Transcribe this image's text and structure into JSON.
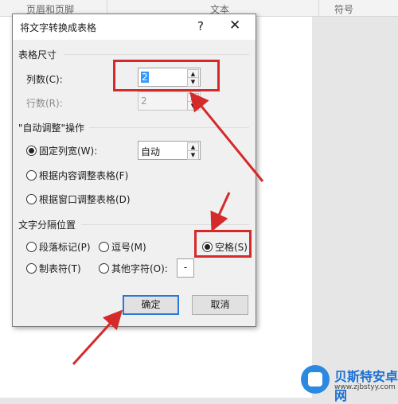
{
  "ribbon": {
    "groups": [
      "页眉和页脚",
      "文本",
      "符号"
    ]
  },
  "dialog": {
    "title": "将文字转换成表格",
    "help": "?",
    "close": "✕",
    "size_group": {
      "label": "表格尺寸",
      "columns_label": "列数(C):",
      "columns_value": "2",
      "rows_label": "行数(R):",
      "rows_value": "2"
    },
    "autofit_group": {
      "label": "\"自动调整\"操作",
      "fixed_label": "固定列宽(W):",
      "fixed_value": "自动",
      "content_label": "根据内容调整表格(F)",
      "window_label": "根据窗口调整表格(D)"
    },
    "separator_group": {
      "label": "文字分隔位置",
      "paragraph_label": "段落标记(P)",
      "comma_label": "逗号(M)",
      "space_label": "空格(S)",
      "tab_label": "制表符(T)",
      "other_label": "其他字符(O):",
      "other_value": "-"
    },
    "ok_label": "确定",
    "cancel_label": "取消"
  },
  "annotation_color": "#d42a2a",
  "watermark": {
    "brand": "贝斯特安卓网",
    "url": "www.zjbstyy.com"
  }
}
